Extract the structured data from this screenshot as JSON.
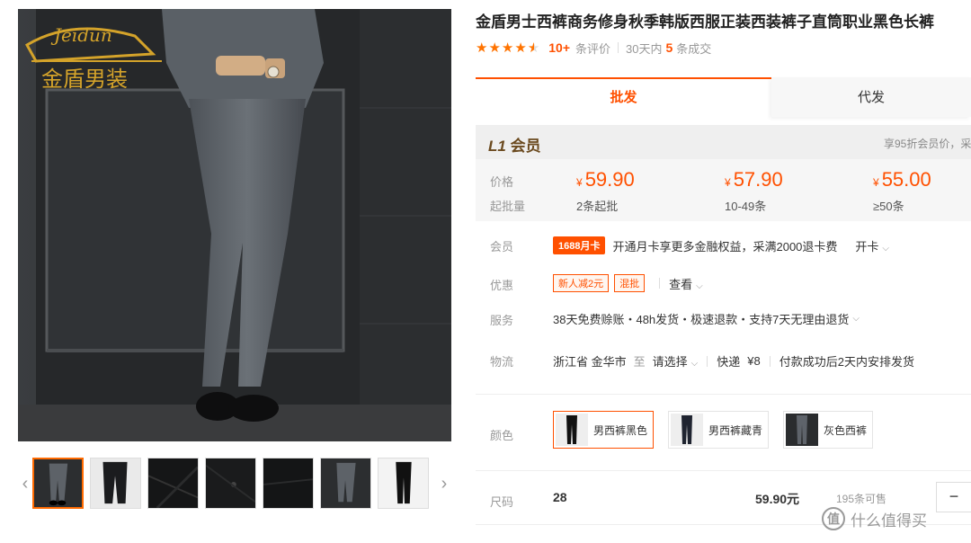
{
  "gallery": {
    "brand_overlay": "金盾男装",
    "logo_script": "Jeidun",
    "thumb_count": 7,
    "active_thumb": 1
  },
  "product": {
    "title": "金盾男士西裤商务修身秋季韩版西服正装西装裤子直筒职业黑色长裤",
    "rating_stars": 4.5,
    "review_count": "10+",
    "review_suffix": "条评价",
    "sales_prefix": "30天内",
    "sales_count": "5",
    "sales_suffix": "条成交"
  },
  "tabs": [
    {
      "label": "批发",
      "active": true
    },
    {
      "label": "代发",
      "active": false
    }
  ],
  "member": {
    "level_code": "L1",
    "level_name": "会员",
    "note": "享95折会员价，采"
  },
  "pricing": {
    "price_label": "价格",
    "qty_label": "起批量",
    "currency": "¥",
    "tiers": [
      {
        "price": "59.90",
        "qty": "2条起批"
      },
      {
        "price": "57.90",
        "qty": "10-49条"
      },
      {
        "price": "55.00",
        "qty": "≥50条"
      }
    ]
  },
  "info": {
    "member_label": "会员",
    "member_tag": "1688月卡",
    "member_text": "开通月卡享更多金融权益，采满2000退卡费",
    "member_link": "开卡",
    "promo_label": "优惠",
    "promo_tags": [
      "新人减2元",
      "混批"
    ],
    "promo_link": "查看",
    "service_label": "服务",
    "service_text": "38天免费赊账・48h发货・极速退款・支持7天无理由退货",
    "logistics_label": "物流",
    "from": "浙江省 金华市",
    "to_word": "至",
    "select_dest": "请选择",
    "express": "快递",
    "express_fee": "¥8",
    "ship_note": "付款成功后2天内安排发货"
  },
  "colors": {
    "label": "颜色",
    "options": [
      {
        "name": "男西裤黑色",
        "selected": true
      },
      {
        "name": "男西裤藏青",
        "selected": false
      },
      {
        "name": "灰色西裤",
        "selected": false
      }
    ]
  },
  "sizes": {
    "label": "尺码",
    "rows": [
      {
        "size": "28",
        "price": "59.90元",
        "stock": "195条可售"
      }
    ],
    "minus": "−"
  },
  "watermark": {
    "icon": "值",
    "text": "什么值得买"
  },
  "palette": {
    "accent": "#ff5000",
    "tab_accent": "#ff5000",
    "star": "#ff7300",
    "gold": "#d4a32a"
  }
}
